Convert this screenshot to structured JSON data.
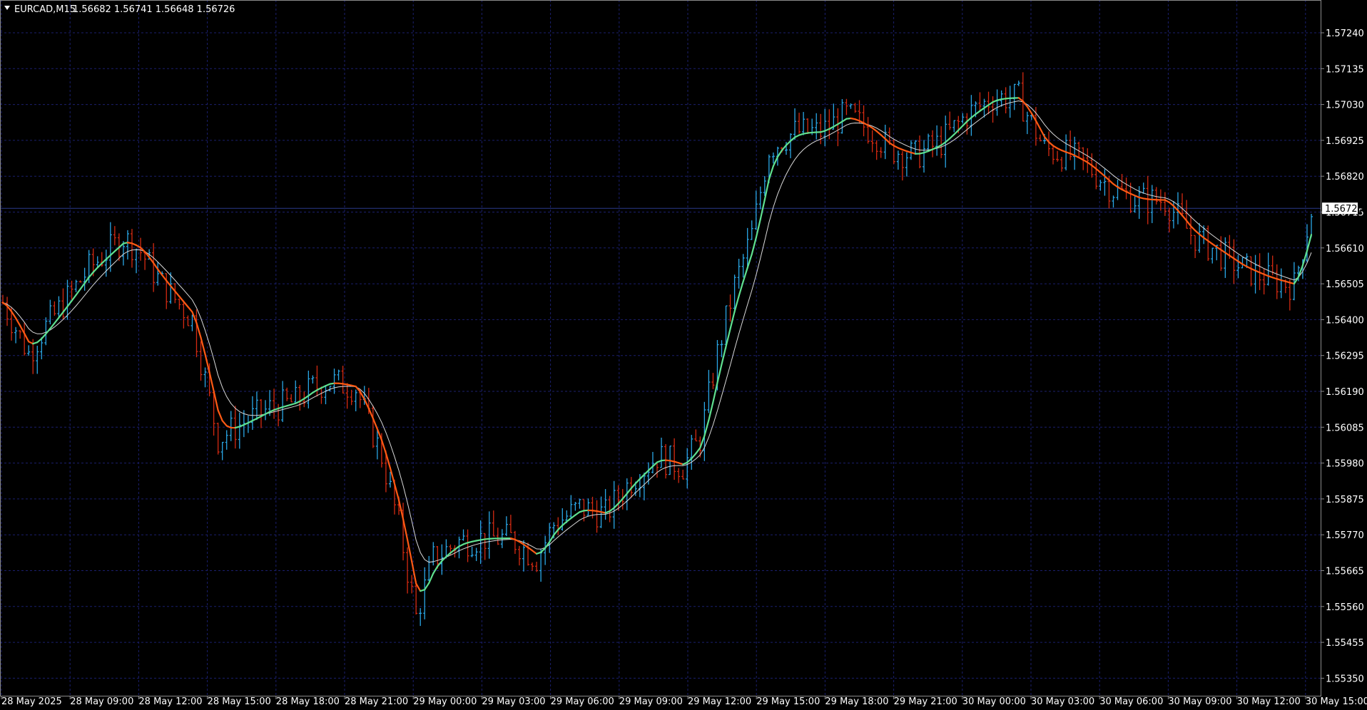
{
  "header": {
    "symbol": "EURCAD,M15",
    "ohlc": "1.56682 1.56741 1.56648 1.56726"
  },
  "colors": {
    "background": "#000000",
    "grid": "#1b1f6e",
    "bull": "#2aa7e6",
    "bear": "#d42a12",
    "ma_fast_up": "#5fe08f",
    "ma_fast_down": "#ff5a14",
    "ma_slow": "#d9d9d9",
    "axis_text": "#ffffff",
    "price_tag_bg": "#ffffff",
    "price_tag_text": "#000000"
  },
  "chart_data": {
    "type": "candlestick",
    "symbol": "EURCAD",
    "timeframe": "M15",
    "current_price": "1.56726",
    "y_ticks": [
      "1.57240",
      "1.57135",
      "1.57030",
      "1.56925",
      "1.56820",
      "1.56715",
      "1.56610",
      "1.56505",
      "1.56400",
      "1.56295",
      "1.56190",
      "1.56085",
      "1.55980",
      "1.55875",
      "1.55770",
      "1.55665",
      "1.55560",
      "1.55455",
      "1.55350"
    ],
    "x_ticks": [
      "28 May 2025",
      "28 May 09:00",
      "28 May 12:00",
      "28 May 15:00",
      "28 May 18:00",
      "28 May 21:00",
      "29 May 00:00",
      "29 May 03:00",
      "29 May 06:00",
      "29 May 09:00",
      "29 May 12:00",
      "29 May 15:00",
      "29 May 18:00",
      "29 May 21:00",
      "30 May 00:00",
      "30 May 03:00",
      "30 May 06:00",
      "30 May 09:00",
      "30 May 12:00",
      "30 May 15:00"
    ],
    "ylim": [
      1.553,
      1.573
    ],
    "grid": true,
    "close_series": [
      [
        0,
        1.5645
      ],
      [
        6,
        1.563
      ],
      [
        10,
        1.5638
      ],
      [
        16,
        1.5648
      ],
      [
        20,
        1.5655
      ],
      [
        28,
        1.5664
      ],
      [
        32,
        1.566
      ],
      [
        36,
        1.5652
      ],
      [
        44,
        1.564
      ],
      [
        50,
        1.5605
      ],
      [
        56,
        1.561
      ],
      [
        62,
        1.5614
      ],
      [
        68,
        1.5616
      ],
      [
        72,
        1.562
      ],
      [
        76,
        1.5622
      ],
      [
        82,
        1.562
      ],
      [
        88,
        1.56
      ],
      [
        92,
        1.558
      ],
      [
        96,
        1.5553
      ],
      [
        100,
        1.557
      ],
      [
        106,
        1.5575
      ],
      [
        112,
        1.5576
      ],
      [
        118,
        1.5576
      ],
      [
        124,
        1.557
      ],
      [
        128,
        1.558
      ],
      [
        134,
        1.5585
      ],
      [
        140,
        1.5583
      ],
      [
        146,
        1.5593
      ],
      [
        152,
        1.56
      ],
      [
        158,
        1.5597
      ],
      [
        162,
        1.5605
      ],
      [
        166,
        1.563
      ],
      [
        170,
        1.565
      ],
      [
        174,
        1.5665
      ],
      [
        178,
        1.569
      ],
      [
        184,
        1.5695
      ],
      [
        190,
        1.5695
      ],
      [
        196,
        1.57
      ],
      [
        202,
        1.5695
      ],
      [
        206,
        1.569
      ],
      [
        212,
        1.5688
      ],
      [
        218,
        1.5692
      ],
      [
        224,
        1.57
      ],
      [
        230,
        1.5705
      ],
      [
        236,
        1.5705
      ],
      [
        242,
        1.569
      ],
      [
        248,
        1.5688
      ],
      [
        252,
        1.5685
      ],
      [
        258,
        1.5678
      ],
      [
        264,
        1.5675
      ],
      [
        270,
        1.5675
      ],
      [
        276,
        1.5665
      ],
      [
        282,
        1.566
      ],
      [
        288,
        1.5655
      ],
      [
        294,
        1.5652
      ],
      [
        300,
        1.565
      ],
      [
        304,
        1.5672
      ]
    ]
  }
}
